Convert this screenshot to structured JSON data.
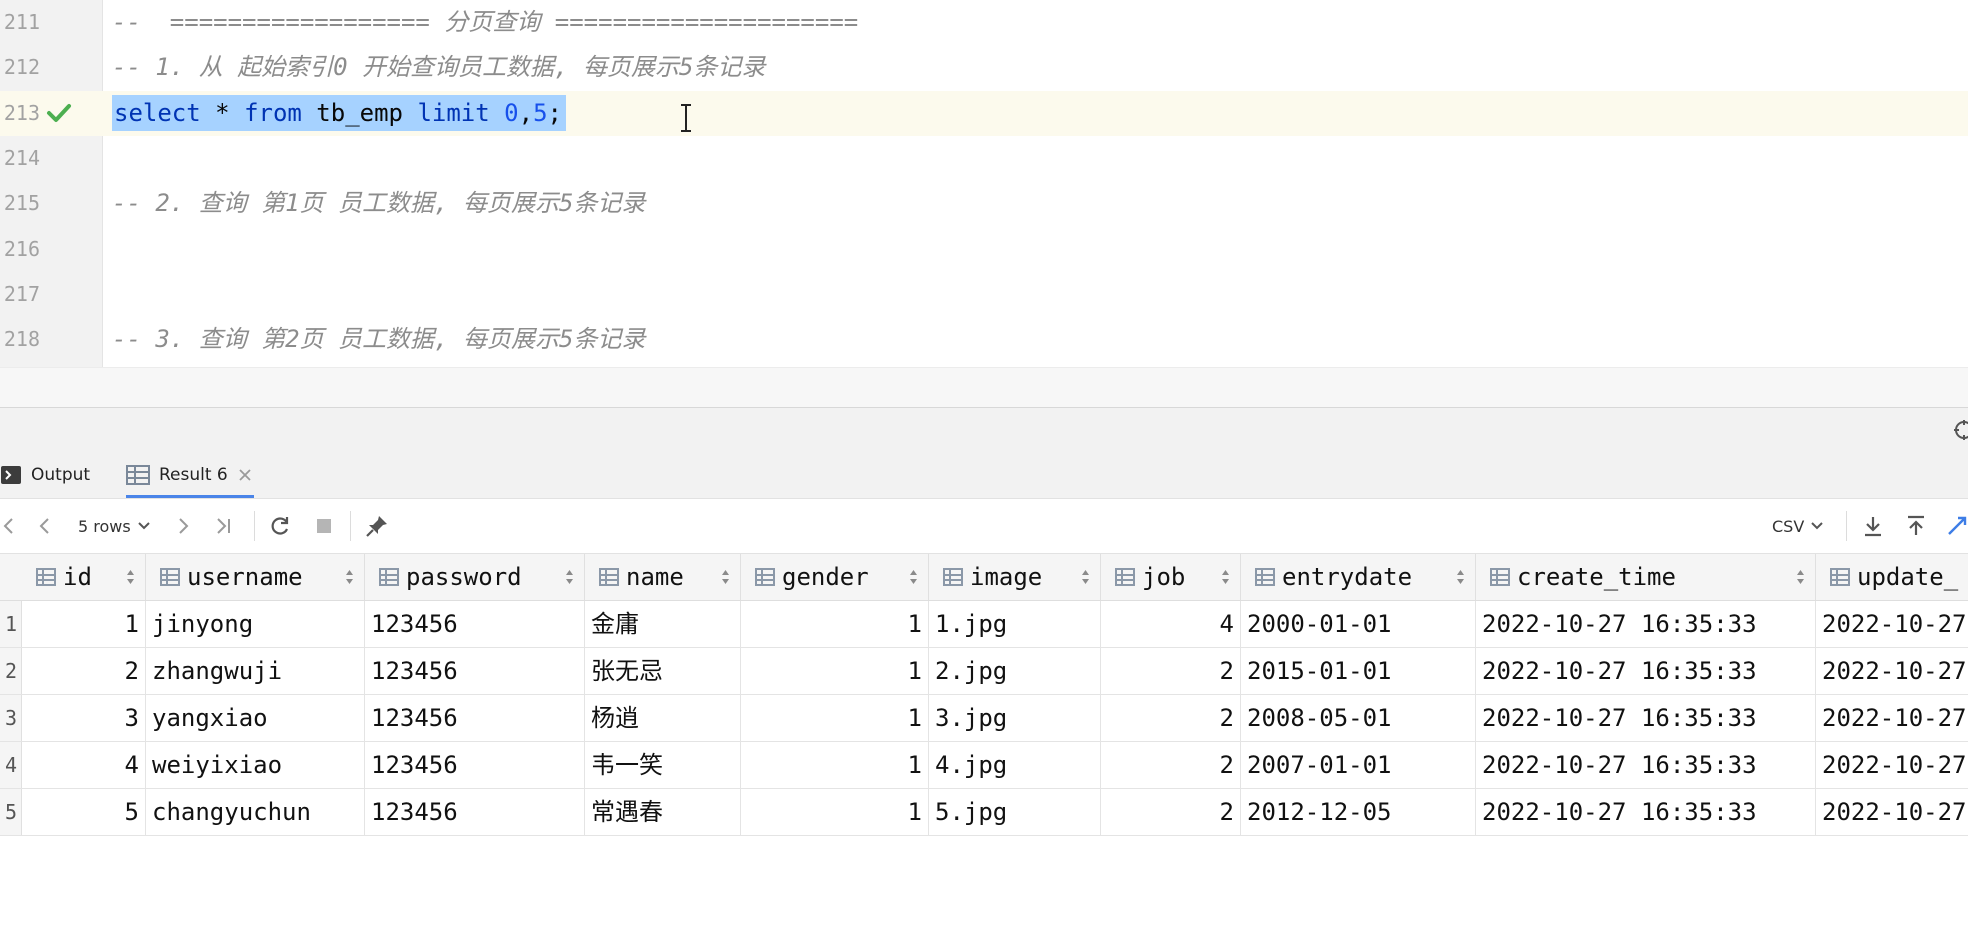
{
  "editor": {
    "lines": [
      {
        "num": "211",
        "text": "--  ================== 分页查询 =====================",
        "kind": "comment"
      },
      {
        "num": "212",
        "text": "-- 1. 从 起始索引0 开始查询员工数据, 每页展示5条记录",
        "kind": "comment"
      },
      {
        "num": "213",
        "kind": "sql",
        "tokens": {
          "select": "select",
          "star": " * ",
          "from": "from",
          "table": " tb_emp ",
          "limit": "limit",
          "offset": " 0",
          "comma": ",",
          "count": "5",
          "semi": ";"
        }
      },
      {
        "num": "214",
        "text": "",
        "kind": "blank"
      },
      {
        "num": "215",
        "text": "-- 2. 查询 第1页 员工数据, 每页展示5条记录",
        "kind": "comment"
      },
      {
        "num": "216",
        "text": "",
        "kind": "blank"
      },
      {
        "num": "217",
        "text": "",
        "kind": "blank"
      },
      {
        "num": "218",
        "text": "-- 3. 查询 第2页 员工数据, 每页展示5条记录",
        "kind": "comment"
      }
    ],
    "execution_status_icon": "check-icon"
  },
  "tabs": [
    {
      "label": "Output",
      "icon": "console-icon"
    },
    {
      "label": "Result 6",
      "icon": "table-icon"
    }
  ],
  "toolbar": {
    "rows_label": "5 rows",
    "export_format": "CSV"
  },
  "grid": {
    "columns": [
      "id",
      "username",
      "password",
      "name",
      "gender",
      "image",
      "job",
      "entrydate",
      "create_time",
      "update_"
    ],
    "rows": [
      {
        "n": "1",
        "cells": [
          "1",
          "jinyong",
          "123456",
          "金庸",
          "1",
          "1.jpg",
          "4",
          "2000-01-01",
          "2022-10-27 16:35:33",
          "2022-10-27"
        ]
      },
      {
        "n": "2",
        "cells": [
          "2",
          "zhangwuji",
          "123456",
          "张无忌",
          "1",
          "2.jpg",
          "2",
          "2015-01-01",
          "2022-10-27 16:35:33",
          "2022-10-27"
        ]
      },
      {
        "n": "3",
        "cells": [
          "3",
          "yangxiao",
          "123456",
          "杨逍",
          "1",
          "3.jpg",
          "2",
          "2008-05-01",
          "2022-10-27 16:35:33",
          "2022-10-27"
        ]
      },
      {
        "n": "4",
        "cells": [
          "4",
          "weiyixiao",
          "123456",
          "韦一笑",
          "1",
          "4.jpg",
          "2",
          "2007-01-01",
          "2022-10-27 16:35:33",
          "2022-10-27"
        ]
      },
      {
        "n": "5",
        "cells": [
          "5",
          "changyuchun",
          "123456",
          "常遇春",
          "1",
          "5.jpg",
          "2",
          "2012-12-05",
          "2022-10-27 16:35:33",
          "2022-10-27"
        ]
      }
    ]
  },
  "colors": {
    "selection": "#a6d2ff",
    "keyword": "#0033b3",
    "comment": "#8c8c8c",
    "number": "#1750eb",
    "success": "#4caf50",
    "accent": "#4a84e8"
  }
}
